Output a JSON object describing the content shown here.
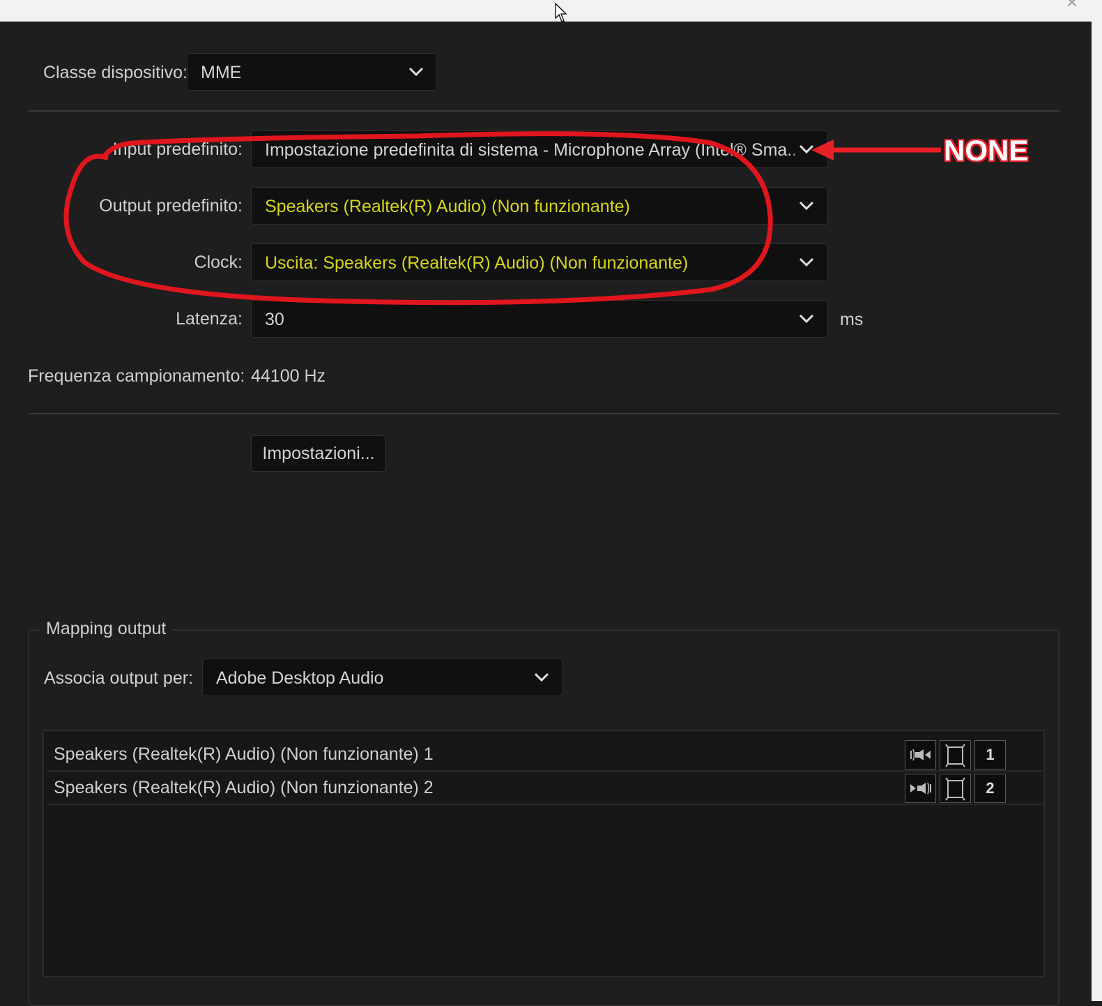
{
  "window": {
    "close_glyph": "✕"
  },
  "device_class": {
    "label": "Classe dispositivo:",
    "value": "MME"
  },
  "default_input": {
    "label": "Input predefinito:",
    "value": "Impostazione predefinita di sistema - Microphone Array (Intel® Sma..."
  },
  "default_output": {
    "label": "Output predefinito:",
    "value": "Speakers (Realtek(R) Audio) (Non funzionante)"
  },
  "clock": {
    "label": "Clock:",
    "value": "Uscita: Speakers (Realtek(R) Audio) (Non funzionante)"
  },
  "latency": {
    "label": "Latenza:",
    "value": "30",
    "unit": "ms"
  },
  "sample_rate": {
    "label": "Frequenza campionamento:",
    "value": "44100 Hz"
  },
  "settings_button": "Impostazioni...",
  "output_mapping": {
    "legend": "Mapping output",
    "map_for": {
      "label": "Associa output per:",
      "value": "Adobe Desktop Audio"
    },
    "channels": [
      {
        "label": "Speakers (Realtek(R) Audio) (Non funzionante) 1",
        "number": "1",
        "icons": [
          "speaker-left-icon",
          "stereo-box-icon"
        ]
      },
      {
        "label": "Speakers (Realtek(R) Audio) (Non funzionante) 2",
        "number": "2",
        "icons": [
          "speaker-right-icon",
          "stereo-box-icon"
        ]
      }
    ]
  },
  "annotation": {
    "text": "NONE",
    "color": "#e8202a"
  },
  "colors": {
    "warning_text": "#d6d61c",
    "background": "#1e1e1e",
    "field_bg": "#101010"
  }
}
